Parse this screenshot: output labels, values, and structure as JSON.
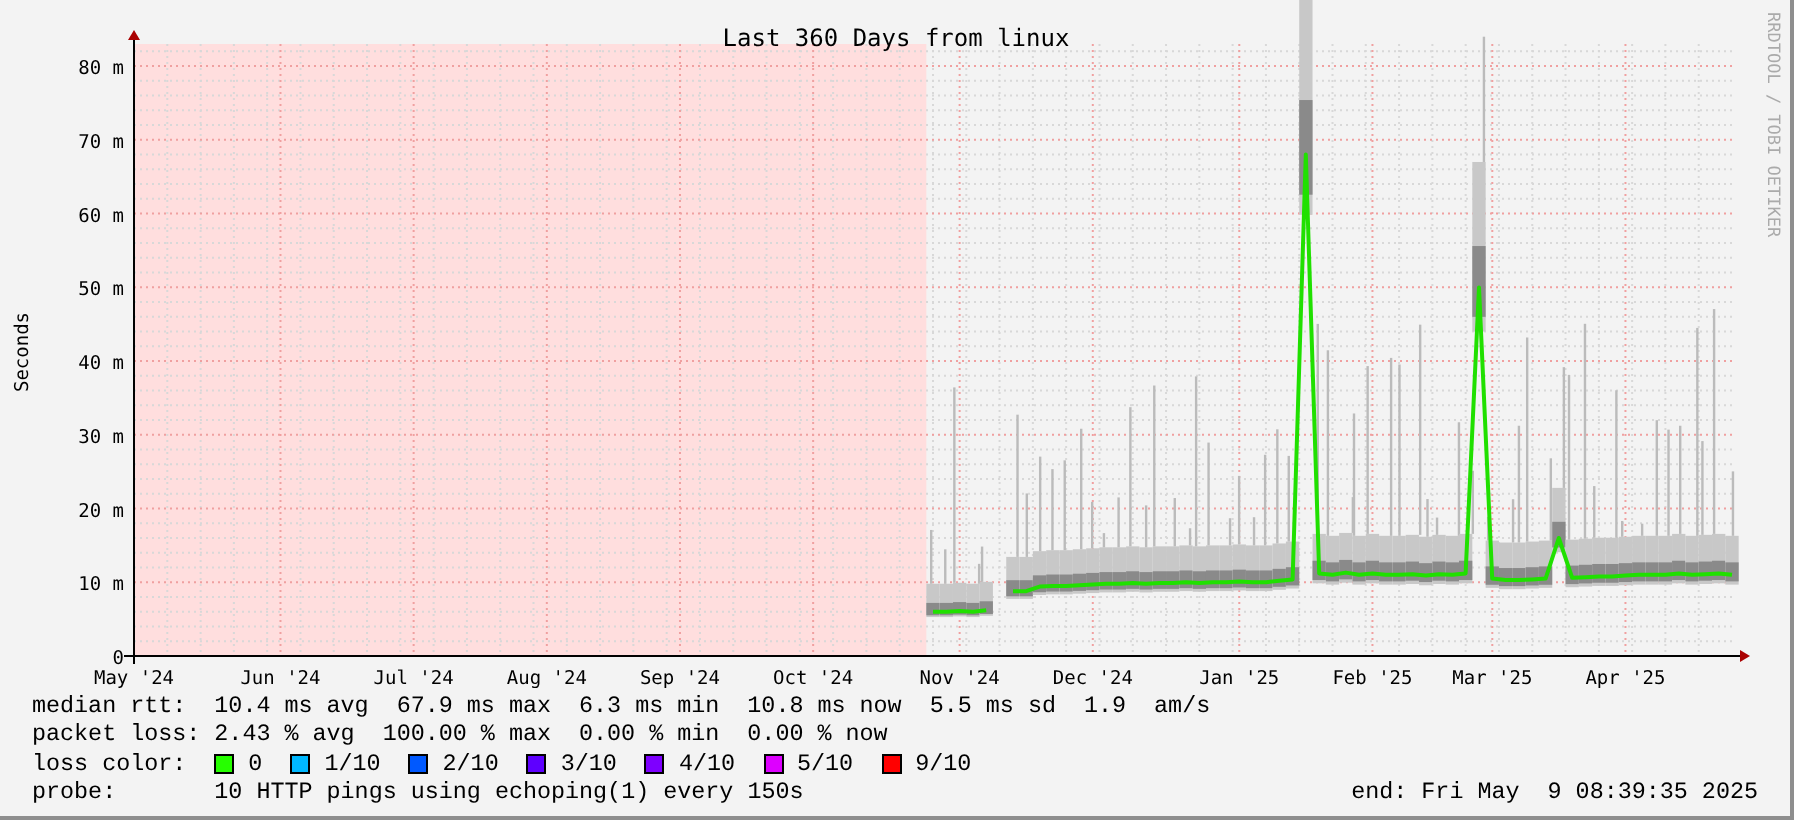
{
  "graph": {
    "title": "Last 360 Days from linux",
    "side_credit": "RRDTOOL / TOBI OETIKER",
    "chart_data": {
      "type": "line",
      "grid": true,
      "ylabel": "Seconds",
      "categories": [
        "May '24",
        null,
        null,
        null,
        null,
        null,
        null,
        null,
        null,
        null,
        null,
        "Jun '24",
        null,
        null,
        null,
        null,
        null,
        null,
        null,
        null,
        null,
        "Jul '24",
        null,
        null,
        null,
        null,
        null,
        null,
        null,
        null,
        null,
        "Aug '24",
        null,
        null,
        null,
        null,
        null,
        null,
        null,
        null,
        null,
        "Sep '24",
        null,
        null,
        null,
        null,
        null,
        null,
        null,
        null,
        null,
        "Oct '24",
        null,
        null,
        null,
        null,
        null,
        null,
        null,
        null,
        null,
        null,
        "Nov '24",
        null,
        null,
        null,
        null,
        null,
        null,
        null,
        null,
        null,
        "Dec '24",
        null,
        null,
        null,
        null,
        null,
        null,
        null,
        null,
        null,
        null,
        "Jan '25",
        null,
        null,
        null,
        null,
        null,
        null,
        null,
        null,
        null,
        "Feb '25",
        null,
        null,
        null,
        null,
        null,
        null,
        null,
        null,
        "Mar '25",
        null,
        null,
        null,
        null,
        null,
        null,
        null,
        null,
        null,
        "Apr '25",
        null,
        null,
        null,
        null,
        null,
        null,
        null,
        null
      ],
      "series": [
        {
          "color": "#20e000",
          "values": [
            null,
            null,
            null,
            null,
            null,
            null,
            null,
            null,
            null,
            null,
            null,
            null,
            null,
            null,
            null,
            null,
            null,
            null,
            null,
            null,
            null,
            null,
            null,
            null,
            null,
            null,
            null,
            null,
            null,
            null,
            null,
            null,
            null,
            null,
            null,
            null,
            null,
            null,
            null,
            null,
            null,
            null,
            null,
            null,
            null,
            null,
            null,
            null,
            null,
            null,
            null,
            null,
            null,
            null,
            null,
            null,
            null,
            null,
            null,
            null,
            6,
            6,
            6.1,
            6,
            6.2,
            null,
            8.8,
            8.8,
            9.4,
            9.5,
            9.5,
            9.6,
            9.7,
            9.8,
            9.8,
            9.9,
            9.8,
            9.9,
            9.9,
            10,
            9.9,
            10,
            10,
            10.1,
            10,
            10,
            10.2,
            10.4,
            68,
            11.2,
            11,
            11.3,
            11,
            11.2,
            11,
            11,
            11.1,
            10.9,
            11.1,
            11,
            11.2,
            50,
            10.5,
            10.3,
            10.3,
            10.4,
            10.5,
            16,
            10.6,
            10.7,
            10.8,
            10.8,
            10.9,
            11,
            11,
            11,
            11.2,
            11,
            11.1,
            11.2,
            11
          ]
        }
      ],
      "ylim": [
        0,
        83
      ],
      "yticks": [
        {
          "value": 0,
          "label": "0"
        },
        {
          "value": 10,
          "label": "10 m"
        },
        {
          "value": 20,
          "label": "20 m"
        },
        {
          "value": 30,
          "label": "30 m"
        },
        {
          "value": 40,
          "label": "40 m"
        },
        {
          "value": 50,
          "label": "50 m"
        },
        {
          "value": 60,
          "label": "60 m"
        },
        {
          "value": 70,
          "label": "70 m"
        },
        {
          "value": 80,
          "label": "80 m"
        }
      ]
    }
  },
  "legend": {
    "rows": [
      {
        "kind": "values",
        "label": "median rtt:",
        "items": [
          "10.4 ms avg",
          "67.9 ms max",
          "6.3 ms min",
          "10.8 ms now",
          "5.5 ms sd",
          "1.9",
          "am/s"
        ]
      },
      {
        "kind": "values",
        "label": "packet loss:",
        "items": [
          "2.43 % avg",
          "100.00 % max",
          "0.00 % min",
          "0.00 % now"
        ]
      },
      {
        "kind": "swatches",
        "label": "loss color:",
        "swatches": [
          {
            "label": "0",
            "color": "#26ff00"
          },
          {
            "label": "1/10",
            "color": "#00b8ff"
          },
          {
            "label": "2/10",
            "color": "#0059ff"
          },
          {
            "label": "3/10",
            "color": "#5e00ff"
          },
          {
            "label": "4/10",
            "color": "#7e00ff"
          },
          {
            "label": "5/10",
            "color": "#dd00ff"
          },
          {
            "label": "9/10",
            "color": "#ff0000"
          }
        ]
      },
      {
        "kind": "values",
        "label": "probe:",
        "items": [
          "10 HTTP pings using echoping(1) every 150s"
        ],
        "end": "end: Fri May  9 08:39:35 2025"
      }
    ]
  }
}
